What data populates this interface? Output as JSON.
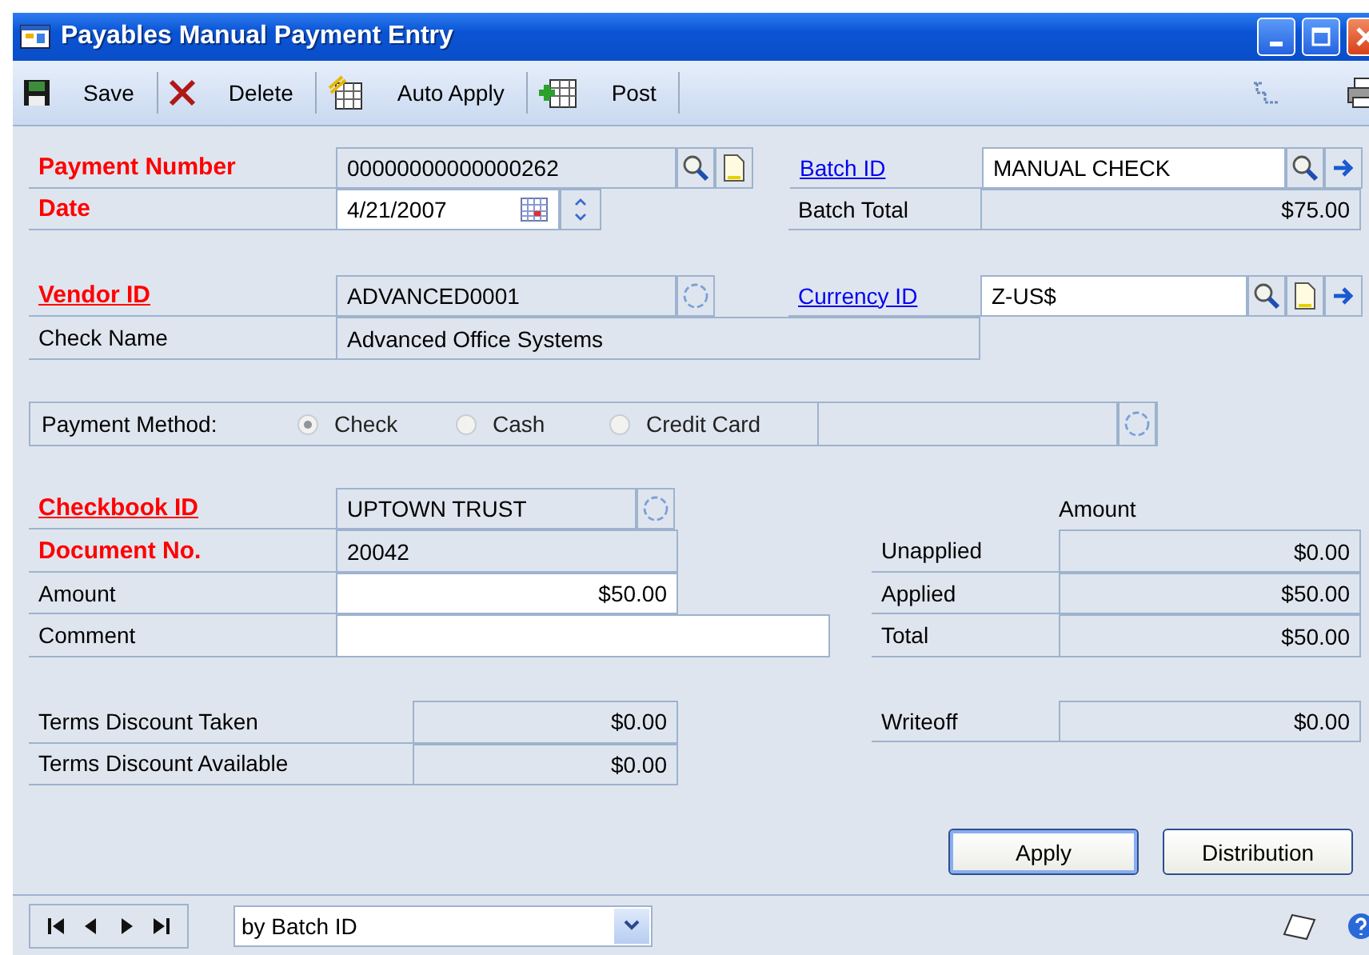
{
  "window": {
    "title": "Payables Manual Payment Entry"
  },
  "toolbar": [
    {
      "label": "Save",
      "kind": "save"
    },
    {
      "label": "Delete",
      "kind": "delete"
    },
    {
      "label": "Auto Apply",
      "kind": "auto-apply"
    },
    {
      "label": "Post",
      "kind": "post"
    }
  ],
  "payment_number": {
    "label": "Payment Number",
    "kind": "required",
    "value": "00000000000000262"
  },
  "date": {
    "label": "Date",
    "kind": "required",
    "value": "4/21/2007"
  },
  "vendor_id": {
    "label": "Vendor ID",
    "kind": "required-link",
    "value": "ADVANCED0001"
  },
  "check_name": {
    "label": "Check Name",
    "value": "Advanced Office Systems"
  },
  "batch_id": {
    "label": "Batch ID",
    "kind": "link",
    "value": "MANUAL CHECK"
  },
  "batch_total": {
    "label": "Batch Total",
    "value": "$75.00"
  },
  "currency_id": {
    "label": "Currency ID",
    "kind": "link",
    "value": "Z-US$"
  },
  "payment_method": {
    "label": "Payment Method:",
    "options": [
      {
        "label": "Check",
        "selected": true
      },
      {
        "label": "Cash",
        "selected": false
      },
      {
        "label": "Credit Card",
        "selected": false
      }
    ]
  },
  "checkbook_id": {
    "label": "Checkbook ID",
    "kind": "required-link",
    "value": "UPTOWN TRUST"
  },
  "document_no": {
    "label": "Document No.",
    "kind": "required",
    "value": "20042"
  },
  "amount": {
    "label": "Amount",
    "value": "$50.00"
  },
  "comment": {
    "label": "Comment"
  },
  "amount_header": "Amount",
  "summary": [
    {
      "label": "Unapplied",
      "value": "$0.00"
    },
    {
      "label": "Applied",
      "value": "$50.00"
    },
    {
      "label": "Total",
      "value": "$50.00"
    }
  ],
  "terms": [
    {
      "label": "Terms Discount Taken",
      "value": "$0.00"
    },
    {
      "label": "Terms Discount Available",
      "value": "$0.00"
    }
  ],
  "writeoff": {
    "label": "Writeoff",
    "value": "$0.00"
  },
  "buttons": [
    "Apply",
    "Distribution"
  ],
  "browse": {
    "value": "by Batch ID"
  }
}
